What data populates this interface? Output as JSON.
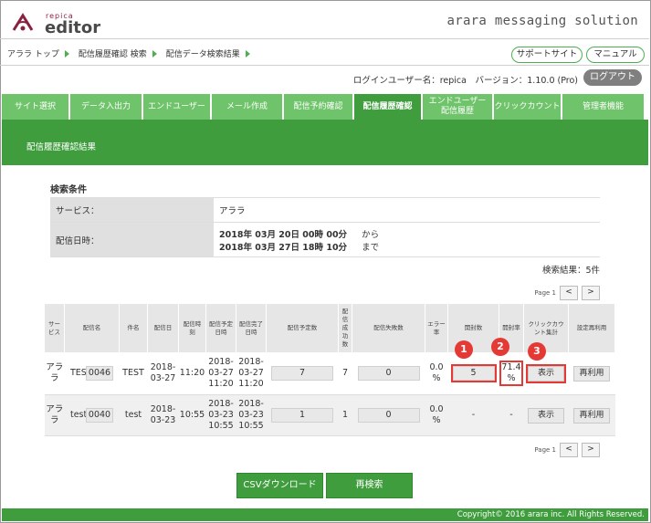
{
  "header": {
    "logo_small": "repica",
    "logo_main": "editor",
    "brand": "arara messaging solution"
  },
  "breadcrumb": [
    "アララ トップ",
    "配信履歴確認 検索",
    "配信データ検索結果"
  ],
  "links": {
    "support": "サポートサイト",
    "manual": "マニュアル"
  },
  "userline": {
    "text": "ログインユーザー名：repica　バージョン：1.10.0 (Pro)"
  },
  "logout_label": "ログアウト",
  "tabs": [
    {
      "label": "サイト選択"
    },
    {
      "label": "データ入出力"
    },
    {
      "label": "エンドユーザー"
    },
    {
      "label": "メール作成"
    },
    {
      "label": "配信予約確認"
    },
    {
      "label": "配信履歴確認"
    },
    {
      "label": "エンドユーザー\n配信履歴"
    },
    {
      "label": "クリックカウント"
    },
    {
      "label": "管理者機能"
    }
  ],
  "page_title": "配信履歴確認結果",
  "conditions": {
    "title": "検索条件",
    "service_label": "サービス：",
    "service_value": "アララ",
    "date_label": "配信日時：",
    "date_from": "2018年 03月 20日 00時 00分",
    "from_word": "から",
    "date_to": "2018年 03月 27日 18時 10分",
    "to_word": "まで"
  },
  "result_count": "検索結果：5件",
  "pager": {
    "page_text": "Page 1",
    "prev": "<",
    "next": ">"
  },
  "table": {
    "headers": [
      "サービス",
      "配信名",
      "件名",
      "配信日",
      "配信時刻",
      "配信予定日時",
      "配信完了日時",
      "配信予定数",
      "配信成功数",
      "配信失敗数",
      "エラー率",
      "開封数",
      "開封率",
      "クリックカウント集計",
      "設定再利用"
    ],
    "rows": [
      {
        "service": "アララ",
        "name": "TEST",
        "id": "0046",
        "subject": "TEST",
        "date": "2018-03-27",
        "time": "11:20",
        "scheduled": "2018-03-27 11:20",
        "completed": "2018-03-27 11:20",
        "planned": "7",
        "success": "7",
        "failed": "0",
        "error_rate": "0.0 %",
        "opens": "5",
        "open_rate": "71.4 %",
        "click_btn": "表示",
        "reuse_btn": "再利用"
      },
      {
        "service": "アララ",
        "name": "test",
        "id": "0040",
        "subject": "test",
        "date": "2018-03-23",
        "time": "10:55",
        "scheduled": "2018-03-23 10:55",
        "completed": "2018-03-23 10:55",
        "planned": "1",
        "success": "1",
        "failed": "0",
        "error_rate": "0.0 %",
        "opens": "-",
        "open_rate": "-",
        "click_btn": "表示",
        "reuse_btn": "再利用"
      }
    ]
  },
  "badges": [
    "1",
    "2",
    "3"
  ],
  "buttons": {
    "csv": "CSVダウンロード",
    "research": "再検索"
  },
  "footer": "Copyright© 2016 arara inc. All Rights Reserved.",
  "colors": {
    "green": "#3f9d3e",
    "tab_green": "#6fc36a",
    "highlight": "#e53935"
  }
}
